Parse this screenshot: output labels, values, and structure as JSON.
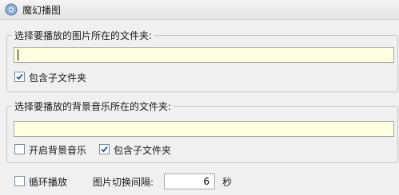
{
  "window": {
    "title": "魔幻播图"
  },
  "images_group": {
    "legend": "选择要播放的图片所在的文件夹:",
    "path_value": "",
    "include_subfolders_label": "包含子文件夹",
    "include_subfolders_checked": true
  },
  "music_group": {
    "legend": "选择要播放的背景音乐所在的文件夹:",
    "path_value": "",
    "enable_music_label": "开启背景音乐",
    "enable_music_checked": false,
    "include_subfolders_label": "包含子文件夹",
    "include_subfolders_checked": true
  },
  "playback": {
    "loop_label": "循环播放",
    "loop_checked": false,
    "interval_label": "图片切换间隔:",
    "interval_value": "6",
    "interval_unit": "秒"
  },
  "colors": {
    "input_bg": "#ffffe1",
    "check_blue": "#1c5aa6"
  }
}
